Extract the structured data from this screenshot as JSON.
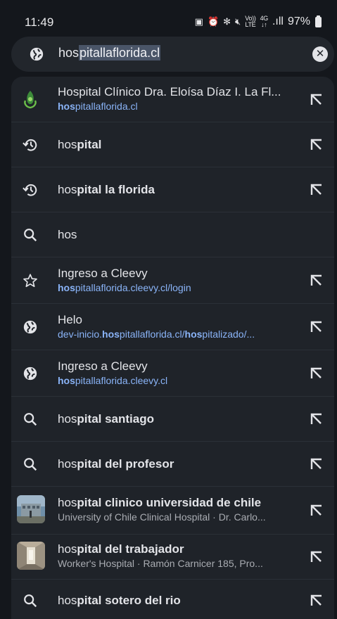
{
  "status": {
    "time": "11:49",
    "network_top": "Vo))",
    "network_bottom": "LTE",
    "network2_top": "4G",
    "network2_bottom": "↓↑",
    "signal": ".ıll",
    "battery": "97%"
  },
  "search": {
    "query_plain": "hos",
    "query_selected": "pitallaflorida.cl"
  },
  "suggestions": [
    {
      "icon": "hospital-favicon",
      "title": "Hospital Clínico Dra. Eloísa Díaz I. La Fl...",
      "sub_bold": "hos",
      "sub_rest": "pitallaflorida.cl"
    },
    {
      "icon": "history-icon",
      "plain": "hos",
      "bold": "pital"
    },
    {
      "icon": "history-icon",
      "plain": "hos",
      "bold": "pital la florida"
    },
    {
      "icon": "search-icon",
      "plain": "hos",
      "bold": ""
    },
    {
      "icon": "star-icon",
      "title": "Ingreso a Cleevy",
      "sub_bold": "hos",
      "sub_rest": "pitallaflorida.cleevy.cl/login"
    },
    {
      "icon": "globe-icon",
      "title": "Helo",
      "sub_a": "dev-inicio.",
      "sub_b": "hos",
      "sub_c": "pitallaflorida.cl/",
      "sub_d": "hos",
      "sub_e": "pitalizado/..."
    },
    {
      "icon": "globe-icon",
      "title": "Ingreso a Cleevy",
      "sub_bold": "hos",
      "sub_rest": "pitallaflorida.cleevy.cl"
    },
    {
      "icon": "search-icon",
      "plain": "hos",
      "bold": "pital santiago"
    },
    {
      "icon": "search-icon",
      "plain": "hos",
      "bold": "pital del profesor"
    },
    {
      "icon": "place-thumbnail",
      "plain": "hos",
      "bold": "pital clinico universidad de chile",
      "sub": "University of Chile Clinical Hospital · Dr. Carlo..."
    },
    {
      "icon": "place-thumbnail",
      "plain": "hos",
      "bold": "pital del trabajador",
      "sub": "Worker's Hospital · Ramón Carnicer 185, Pro..."
    },
    {
      "icon": "search-icon",
      "plain": "hos",
      "bold": "pital sotero del rio"
    }
  ],
  "colors": {
    "background": "#14171c",
    "panel": "#1f2329",
    "link": "#8ab4f8",
    "text": "#e3e4e8"
  }
}
